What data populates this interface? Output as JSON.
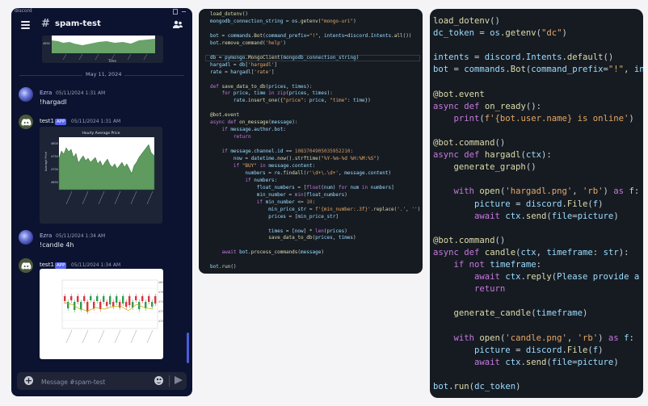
{
  "discord": {
    "app_label": "discord",
    "channel": "spam-test",
    "date_divider": "May 11, 2024",
    "messages": [
      {
        "author": "Ezra",
        "time": "05/11/2024 1:31 AM",
        "text": "!hargadl"
      },
      {
        "author": "test1",
        "badge": "APP",
        "time": "05/11/2024 1:31 AM",
        "embed_title": "Hourly Average Price"
      },
      {
        "author": "Ezra",
        "time": "05/11/2024 1:34 AM",
        "text": "!candle 4h"
      },
      {
        "author": "test1",
        "badge": "APP",
        "time": "05/11/2024 1:34 AM"
      }
    ],
    "composer_placeholder": "Message #spam-test",
    "top_chart_label": "Time"
  },
  "colors": {
    "discord_bg": "#0c1330",
    "accent": "#5865f2",
    "code_bg": "#161b22"
  },
  "code_small": [
    "load_dotenv()",
    "mongodb_connection_string = os.getenv(\"mongo-uri\")",
    "",
    "bot = commands.Bot(command_prefix=\"!\", intents=discord.Intents.all())",
    "bot.remove_command('help')",
    "",
    "db = pymongo.MongoClient(mongodb_connection_string)",
    "hargadl = db['hargadl']",
    "rate = hargadl['rate']",
    "",
    "def save_data_to_db(prices, times):",
    "    for price, time in zip(prices, times):",
    "        rate.insert_one({\"price\": price, \"time\": time})",
    "",
    "@bot.event",
    "async def on_message(message):",
    "    if message.author.bot:",
    "        return",
    "",
    "    if message.channel.id == 1083704905035952210:",
    "        now = datetime.now().strftime(\"%Y-%m-%d %H:%M:%S\")",
    "        if \"BUY\" in message.content:",
    "            numbers = re.findall(r'\\d+\\.\\d+', message.content)",
    "            if numbers:",
    "                float_numbers = [float(num) for num in numbers]",
    "                min_number = min(float_numbers)",
    "                if min_number <= 10:",
    "                    min_price_str = f'{min_number:.3f}'.replace('.', '')",
    "                    prices = [min_price_str]",
    "",
    "                    times = [now] * len(prices)",
    "                    save_data_to_db(prices, times)",
    "",
    "    await bot.process_commands(message)",
    "",
    "bot.run()"
  ],
  "code_large": [
    "load_dotenv()",
    "dc_token = os.getenv(\"dc\")",
    "",
    "intents = discord.Intents.default()",
    "bot = commands.Bot(command_prefix=\"!\", intents",
    "",
    "@bot.event",
    "async def on_ready():",
    "    print(f'{bot.user.name} is online')",
    "",
    "@bot.command()",
    "async def hargadl(ctx):",
    "    generate_graph()",
    "",
    "    with open('hargadl.png', 'rb') as f:",
    "        picture = discord.File(f)",
    "        await ctx.send(file=picture)",
    "",
    "@bot.command()",
    "async def candle(ctx, timeframe: str):",
    "    if not timeframe:",
    "        await ctx.reply(\"Please provide a t",
    "        return",
    "",
    "    generate_candle(timeframe)",
    "",
    "    with open('candle.png', 'rb') as f:",
    "        picture = discord.File(f)",
    "        await ctx.send(file=picture)",
    "",
    "bot.run(dc_token)"
  ]
}
